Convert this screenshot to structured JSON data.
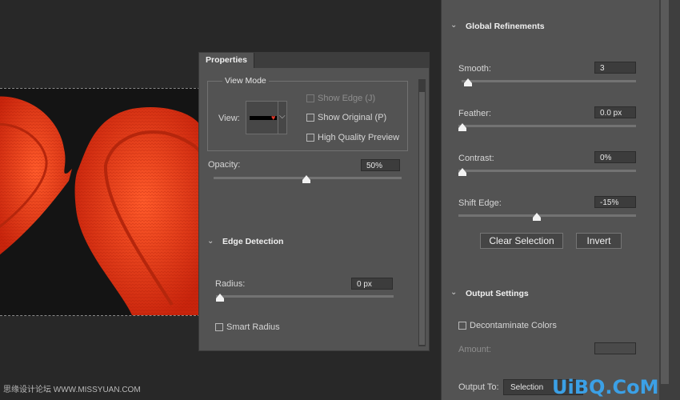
{
  "properties_panel": {
    "tab_label": "Properties",
    "view_mode": {
      "legend": "View Mode",
      "view_label": "View:",
      "show_edge_label": "Show Edge (J)",
      "show_original_label": "Show Original (P)",
      "high_quality_label": "High Quality Preview"
    },
    "opacity": {
      "label": "Opacity:",
      "value": "50%",
      "slider_fraction": 0.5
    },
    "edge_detection": {
      "title": "Edge Detection",
      "radius_label": "Radius:",
      "radius_value": "0 px",
      "radius_fraction": 0.0,
      "smart_radius_label": "Smart Radius"
    }
  },
  "global_refinements": {
    "title": "Global Refinements",
    "smooth": {
      "label": "Smooth:",
      "value": "3",
      "fraction": 0.03
    },
    "feather": {
      "label": "Feather:",
      "value": "0.0 px",
      "fraction": 0.0
    },
    "contrast": {
      "label": "Contrast:",
      "value": "0%",
      "fraction": 0.0
    },
    "shift_edge": {
      "label": "Shift Edge:",
      "value": "-15%",
      "fraction": 0.43
    },
    "clear_selection_label": "Clear Selection",
    "invert_label": "Invert"
  },
  "output_settings": {
    "title": "Output Settings",
    "decontaminate_label": "Decontaminate Colors",
    "amount_label": "Amount:",
    "output_to_label": "Output To:",
    "output_to_value": "Selection"
  },
  "watermarks": {
    "left": "思缘设计论坛 WWW.MISSYUAN.COM",
    "right": "UiBQ.CoM"
  },
  "colors": {
    "panel_bg": "#535353",
    "app_bg": "#282828",
    "heart_red": "#e8371e"
  }
}
